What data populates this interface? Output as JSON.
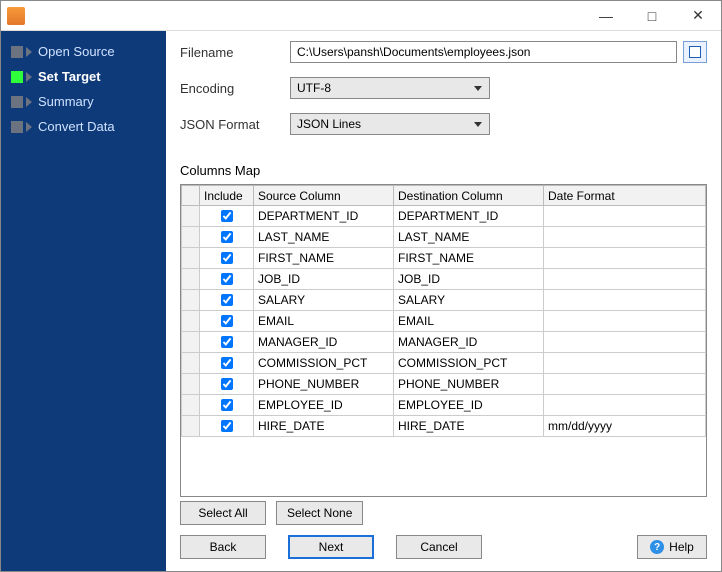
{
  "window": {
    "minimize_glyph": "—",
    "maximize_glyph": "□",
    "close_glyph": "✕"
  },
  "nav": {
    "items": [
      {
        "label": "Open Source",
        "active": false
      },
      {
        "label": "Set Target",
        "active": true
      },
      {
        "label": "Summary",
        "active": false
      },
      {
        "label": "Convert Data",
        "active": false
      }
    ]
  },
  "form": {
    "filename_label": "Filename",
    "filename_value": "C:\\Users\\pansh\\Documents\\employees.json",
    "encoding_label": "Encoding",
    "encoding_value": "UTF-8",
    "json_format_label": "JSON Format",
    "json_format_value": "JSON Lines"
  },
  "columns": {
    "section_label": "Columns Map",
    "headers": {
      "include": "Include",
      "source": "Source Column",
      "destination": "Destination Column",
      "date_format": "Date Format"
    },
    "rows": [
      {
        "checked": true,
        "source": "DEPARTMENT_ID",
        "destination": "DEPARTMENT_ID",
        "date_format": ""
      },
      {
        "checked": true,
        "source": "LAST_NAME",
        "destination": "LAST_NAME",
        "date_format": ""
      },
      {
        "checked": true,
        "source": "FIRST_NAME",
        "destination": "FIRST_NAME",
        "date_format": ""
      },
      {
        "checked": true,
        "source": "JOB_ID",
        "destination": "JOB_ID",
        "date_format": ""
      },
      {
        "checked": true,
        "source": "SALARY",
        "destination": "SALARY",
        "date_format": ""
      },
      {
        "checked": true,
        "source": "EMAIL",
        "destination": "EMAIL",
        "date_format": ""
      },
      {
        "checked": true,
        "source": "MANAGER_ID",
        "destination": "MANAGER_ID",
        "date_format": ""
      },
      {
        "checked": true,
        "source": "COMMISSION_PCT",
        "destination": "COMMISSION_PCT",
        "date_format": ""
      },
      {
        "checked": true,
        "source": "PHONE_NUMBER",
        "destination": "PHONE_NUMBER",
        "date_format": ""
      },
      {
        "checked": true,
        "source": "EMPLOYEE_ID",
        "destination": "EMPLOYEE_ID",
        "date_format": ""
      },
      {
        "checked": true,
        "source": "HIRE_DATE",
        "destination": "HIRE_DATE",
        "date_format": "mm/dd/yyyy"
      }
    ]
  },
  "buttons": {
    "select_all": "Select All",
    "select_none": "Select None",
    "back": "Back",
    "next": "Next",
    "cancel": "Cancel",
    "help": "Help"
  }
}
